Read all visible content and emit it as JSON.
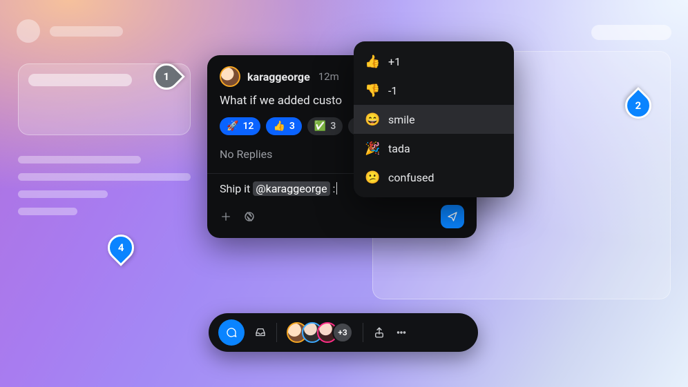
{
  "callouts": {
    "c1": "1",
    "c2": "2",
    "c4": "4"
  },
  "thread": {
    "author": "karaggeorge",
    "time": "12m",
    "message": "What if we added custo",
    "reactions": [
      {
        "emoji": "🚀",
        "count": "12"
      },
      {
        "emoji": "👍",
        "count": "3"
      },
      {
        "emoji": "✅",
        "count": "3"
      }
    ],
    "no_replies": "No Replies",
    "compose_prefix": "Ship it ",
    "compose_mention": "@karaggeorge",
    "compose_suffix": "  :"
  },
  "picker": {
    "items": [
      {
        "emoji": "👍",
        "label": "+1"
      },
      {
        "emoji": "👎",
        "label": "-1"
      },
      {
        "emoji": "😄",
        "label": "smile"
      },
      {
        "emoji": "🎉",
        "label": "tada"
      },
      {
        "emoji": "😕",
        "label": "confused"
      }
    ],
    "selected_index": 2
  },
  "dock": {
    "avatar_borders": [
      "#f5a623",
      "#3da9ff",
      "#ff2d88"
    ],
    "more_count": "+3"
  }
}
